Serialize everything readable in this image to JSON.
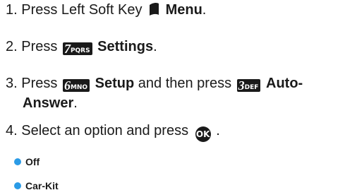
{
  "steps": [
    {
      "num": "1.",
      "text_before": "Press Left Soft Key",
      "key_icon": "left-soft-key-icon",
      "bold": "Menu",
      "after": "."
    },
    {
      "num": "2.",
      "text_before": "Press",
      "key": {
        "digit": "7",
        "letters": "PQRS"
      },
      "bold": "Settings",
      "after": "."
    },
    {
      "num": "3.",
      "text_before": "Press",
      "key1": {
        "digit": "6",
        "letters": "MNO"
      },
      "bold1": "Setup",
      "middle": "and then press",
      "key2": {
        "digit": "3",
        "letters": "DEF"
      },
      "bold2_line1": "Auto-",
      "bold2_line2": "Answer",
      "after": "."
    },
    {
      "num": "4.",
      "text": "Select an option and press",
      "ok_label": "OK",
      "after": "."
    }
  ],
  "options": [
    "Off",
    "Car-Kit"
  ],
  "colors": {
    "bullet": "#2b9be6",
    "text": "#1a1a1a",
    "keycap": "#1a1a1a"
  }
}
